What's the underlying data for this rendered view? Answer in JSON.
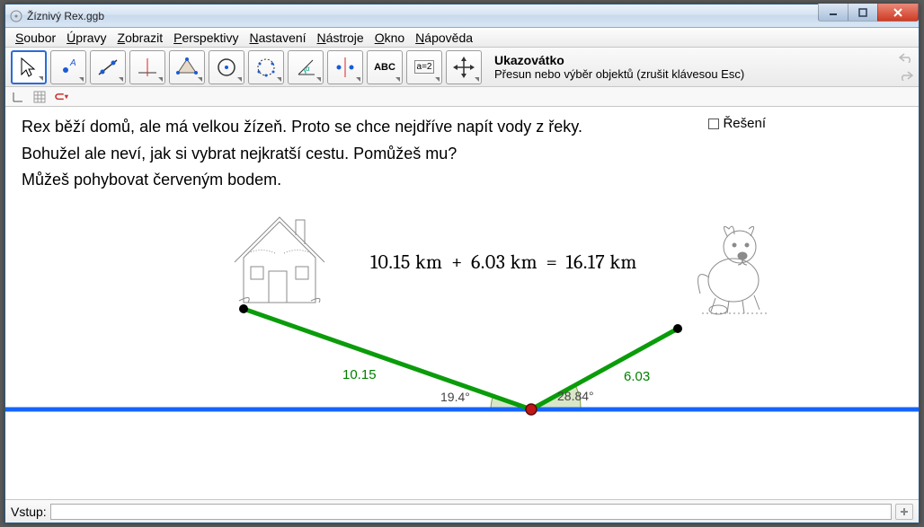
{
  "window": {
    "title": "Žíznivý Rex.ggb"
  },
  "menu": {
    "items": [
      "Soubor",
      "Úpravy",
      "Zobrazit",
      "Perspektivy",
      "Nastavení",
      "Nástroje",
      "Okno",
      "Nápověda"
    ]
  },
  "tool_hint": {
    "title": "Ukazovátko",
    "desc": "Přesun nebo výběr objektů (zrušit klávesou Esc)"
  },
  "tools": [
    {
      "name": "move",
      "sel": true
    },
    {
      "name": "point",
      "sel": false
    },
    {
      "name": "line",
      "sel": false
    },
    {
      "name": "perp",
      "sel": false
    },
    {
      "name": "polygon",
      "sel": false
    },
    {
      "name": "circle",
      "sel": false
    },
    {
      "name": "ellipse",
      "sel": false
    },
    {
      "name": "angle",
      "sel": false
    },
    {
      "name": "reflect",
      "sel": false
    },
    {
      "name": "text",
      "sel": false,
      "label": "ABC"
    },
    {
      "name": "slider",
      "sel": false,
      "label": "a=2"
    },
    {
      "name": "pan",
      "sel": false
    }
  ],
  "problem": {
    "line1": "Rex běží domů, ale má velkou žízeň. Proto se chce nejdříve napít vody z řeky.",
    "line2": "Bohužel ale neví, jak si vybrat nejkratší cestu. Pomůžeš mu?",
    "line3": "Můžeš pohybovat červeným bodem."
  },
  "solution_label": "Řešení",
  "equation": {
    "a": "10.15 km",
    "b": "6.03 km",
    "sum": "16.17 km"
  },
  "segments": {
    "left": "10.15",
    "right": "6.03"
  },
  "angles": {
    "left": "19.4°",
    "right": "28.84°"
  },
  "input_label": "Vstup:",
  "input_value": ""
}
